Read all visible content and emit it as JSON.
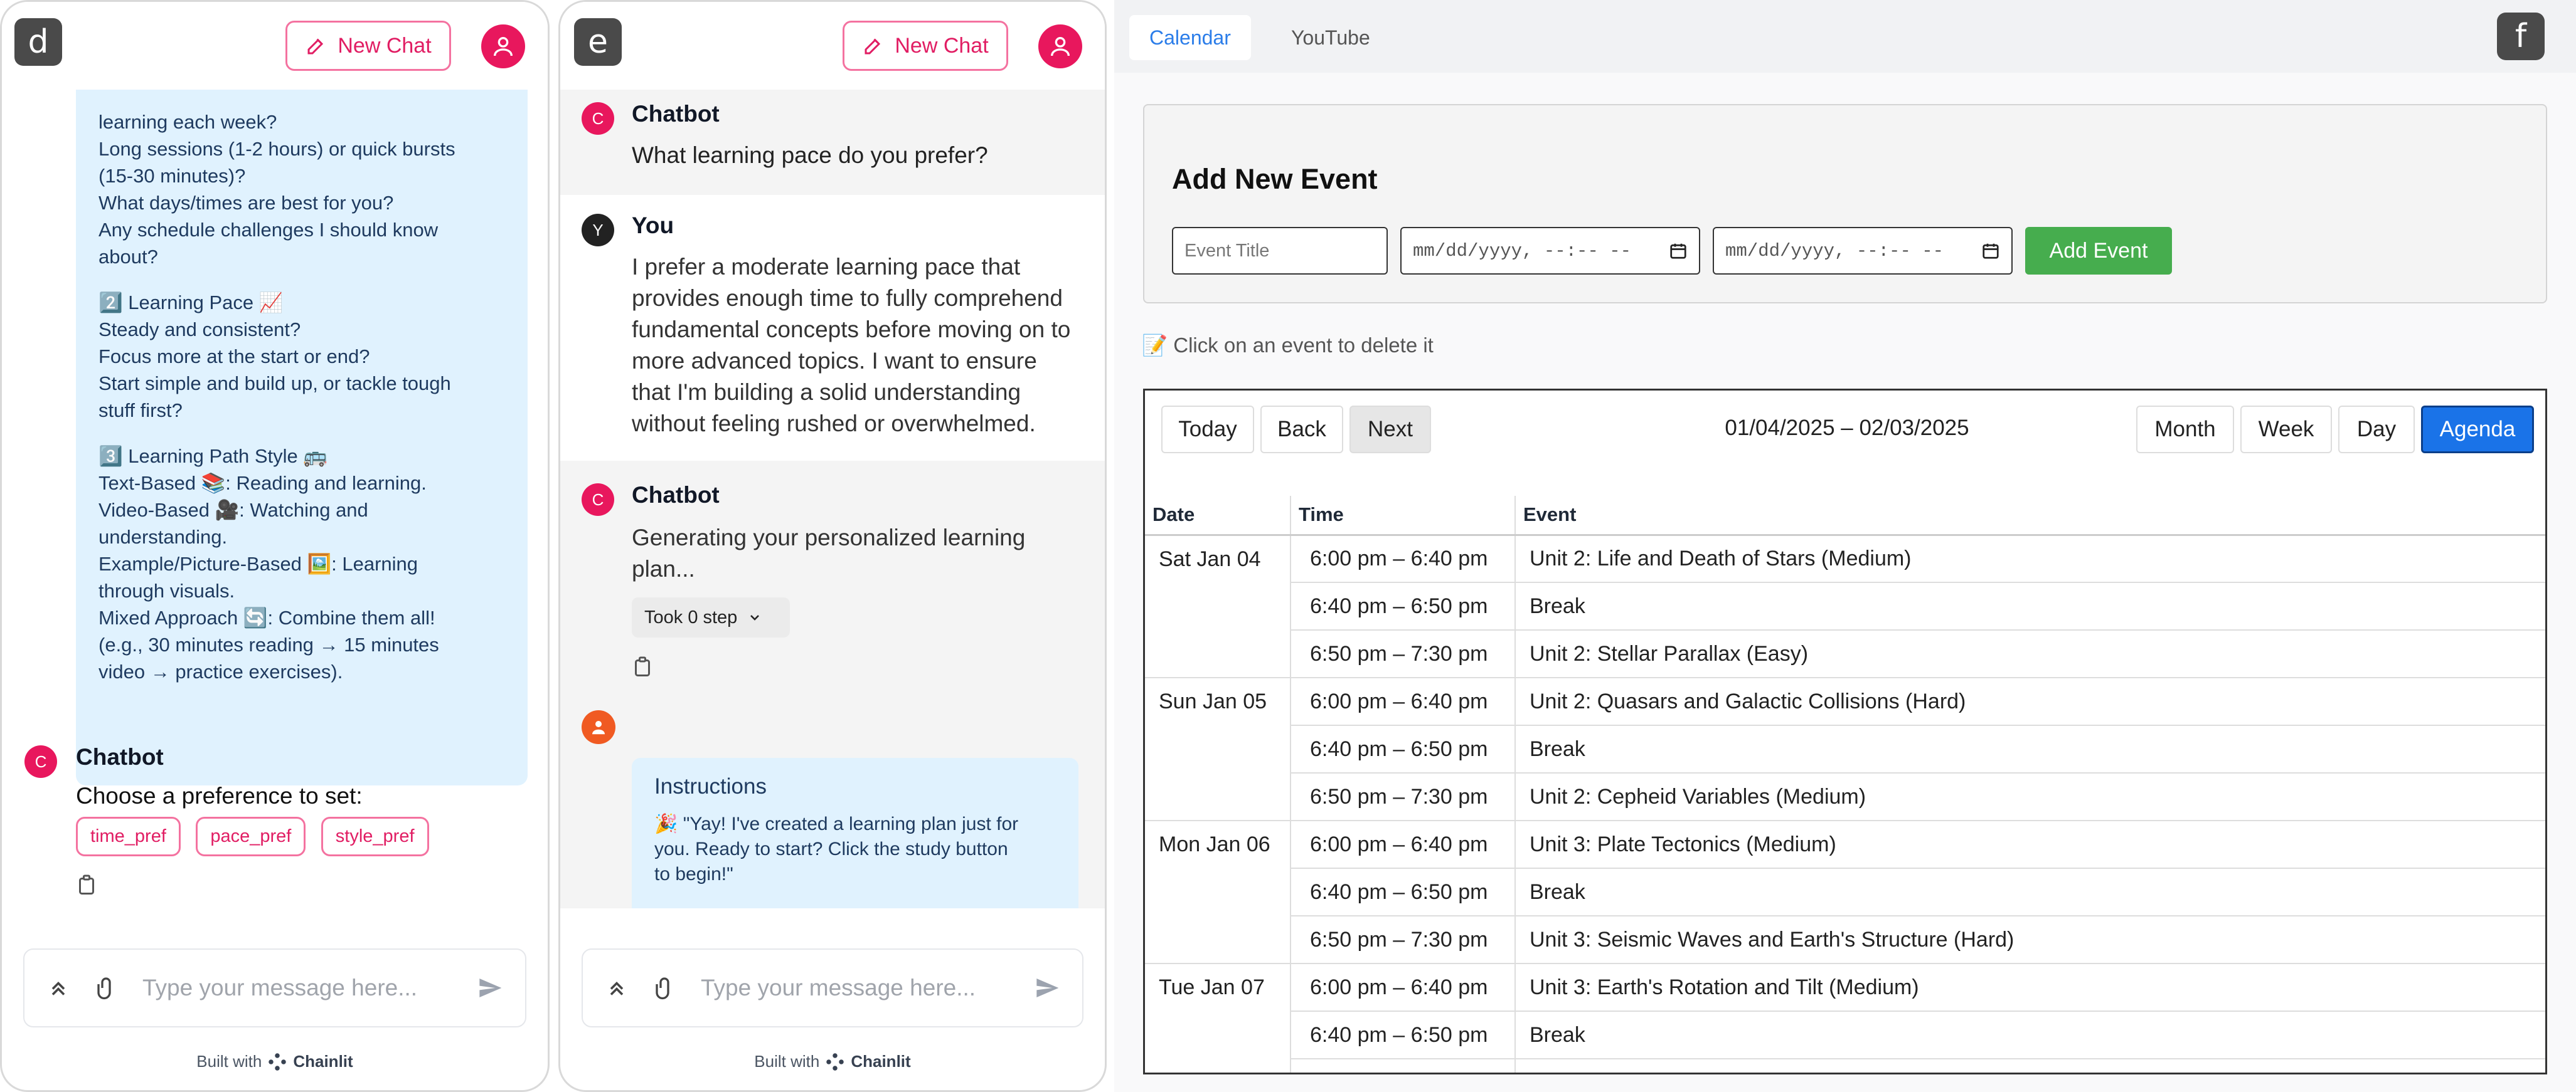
{
  "panel_d": {
    "badge": "d",
    "new_chat": "New Chat",
    "bot_lines": [
      "learning each week?",
      "Long sessions (1-2 hours) or quick bursts",
      "(15-30 minutes)?",
      "What days/times are best for you?",
      "Any schedule challenges I should know",
      "about?",
      "",
      "2️⃣ Learning Pace 📈",
      "Steady and consistent?",
      "Focus more at the start or end?",
      "Start simple and build up, or tackle tough",
      "stuff first?",
      "",
      "3️⃣ Learning Path Style 🚌",
      "Text-Based 📚: Reading and learning.",
      "Video-Based 🎥: Watching and",
      "understanding.",
      "Example/Picture-Based 🖼️: Learning",
      "through visuals.",
      "Mixed Approach 🔄: Combine them all!",
      "(e.g., 30 minutes reading → 15 minutes",
      "video → practice exercises)."
    ],
    "chatbot_name": "Chatbot",
    "chatbot_avatar": "C",
    "prompt": "Choose a preference to set:",
    "chips": [
      "time_pref",
      "pace_pref",
      "style_pref"
    ],
    "placeholder": "Type your message here...",
    "built_with": "Built with",
    "brand": "Chainlit"
  },
  "panel_e": {
    "badge": "e",
    "new_chat": "New Chat",
    "chatbot_name": "Chatbot",
    "chatbot_avatar": "C",
    "q1": "What learning pace do you prefer?",
    "you_name": "You",
    "you_avatar": "Y",
    "you_lines": [
      "I prefer a moderate learning pace that",
      "provides enough time to fully comprehend",
      "fundamental concepts before moving on to",
      "more advanced topics. I want to ensure",
      "that I'm building a solid understanding",
      "without feeling rushed or overwhelmed."
    ],
    "gen_lines": [
      "Generating your personalized learning",
      "plan..."
    ],
    "took_step": "Took 0 step",
    "instructions_title": "Instructions",
    "instructions_lines": [
      "🎉 \"Yay! I've created a learning plan just for",
      "you. Ready to start? Click the study button",
      "to begin!\""
    ],
    "placeholder": "Type your message here...",
    "built_with": "Built with",
    "brand": "Chainlit"
  },
  "panel_f": {
    "badge": "f",
    "tabs": [
      "Calendar",
      "YouTube"
    ],
    "form_title": "Add New Event",
    "title_placeholder": "Event Title",
    "date_placeholder_1": "mm/dd/yyyy, --:-- --",
    "date_placeholder_2": "mm/dd/yyyy, --:-- --",
    "add_event": "Add Event",
    "hint": "📝 Click on an event to delete it",
    "nav": {
      "today": "Today",
      "back": "Back",
      "next": "Next"
    },
    "range": "01/04/2025 – 02/03/2025",
    "views": {
      "month": "Month",
      "week": "Week",
      "day": "Day",
      "agenda": "Agenda"
    },
    "columns": [
      "Date",
      "Time",
      "Event"
    ],
    "days": [
      {
        "date": "Sat Jan 04",
        "rows": [
          {
            "time": "6:00 pm – 6:40 pm",
            "event": "Unit 2: Life and Death of Stars (Medium)"
          },
          {
            "time": "6:40 pm – 6:50 pm",
            "event": "Break"
          },
          {
            "time": "6:50 pm – 7:30 pm",
            "event": "Unit 2: Stellar Parallax (Easy)"
          }
        ]
      },
      {
        "date": "Sun Jan 05",
        "rows": [
          {
            "time": "6:00 pm – 6:40 pm",
            "event": "Unit 2: Quasars and Galactic Collisions (Hard)"
          },
          {
            "time": "6:40 pm – 6:50 pm",
            "event": "Break"
          },
          {
            "time": "6:50 pm – 7:30 pm",
            "event": "Unit 2: Cepheid Variables (Medium)"
          }
        ]
      },
      {
        "date": "Mon Jan 06",
        "rows": [
          {
            "time": "6:00 pm – 6:40 pm",
            "event": "Unit 3: Plate Tectonics (Medium)"
          },
          {
            "time": "6:40 pm – 6:50 pm",
            "event": "Break"
          },
          {
            "time": "6:50 pm – 7:30 pm",
            "event": "Unit 3: Seismic Waves and Earth's Structure (Hard)"
          }
        ]
      },
      {
        "date": "Tue Jan 07",
        "rows": [
          {
            "time": "6:00 pm – 6:40 pm",
            "event": "Unit 3: Earth's Rotation and Tilt (Medium)"
          },
          {
            "time": "6:40 pm – 6:50 pm",
            "event": "Break"
          },
          {
            "time": "",
            "event": ""
          }
        ]
      }
    ]
  }
}
